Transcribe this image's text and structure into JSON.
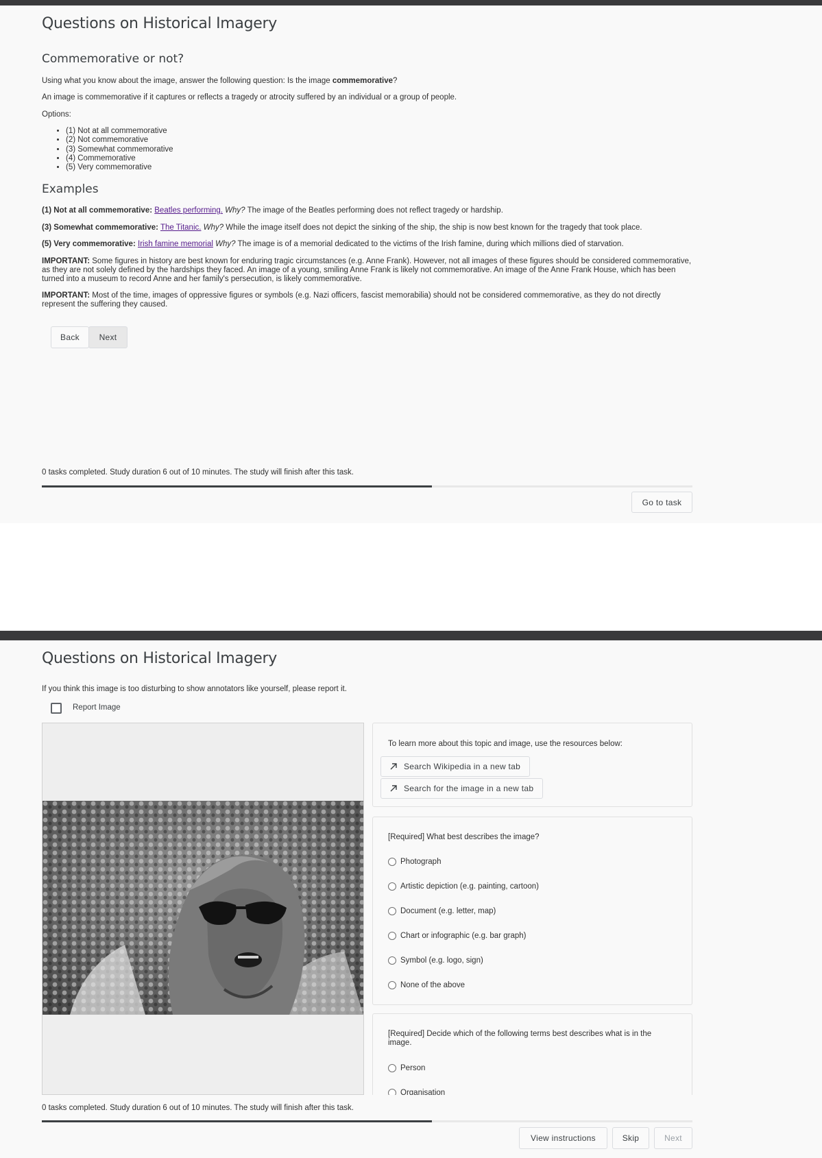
{
  "instructions_page": {
    "title": "Questions on Historical Imagery",
    "section_title": "Commemorative or not?",
    "intro_prefix": "Using what you know about the image, answer the following question: Is the image ",
    "intro_bold": "commemorative",
    "intro_suffix": "?",
    "definition": "An image is commemorative if it captures or reflects a tragedy or atrocity suffered by an individual or a group of people.",
    "options_label": "Options:",
    "options": [
      "(1) Not at all commemorative",
      "(2) Not commemorative",
      "(3) Somewhat commemorative",
      "(4) Commemorative",
      "(5) Very commemorative"
    ],
    "examples_title": "Examples",
    "examples": [
      {
        "label": "(1) Not at all commemorative:",
        "link": "Beatles performing.",
        "why": "Why?",
        "text": " The image of the Beatles performing does not reflect tragedy or hardship."
      },
      {
        "label": "(3) Somewhat commemorative:",
        "link": "The Titanic.",
        "why": "Why?",
        "text": " While the image itself does not depict the sinking of the ship, the ship is now best known for the tragedy that took place."
      },
      {
        "label": "(5) Very commemorative:",
        "link": "Irish famine memorial",
        "why": "Why?",
        "text": " The image is of a memorial dedicated to the victims of the Irish famine, during which millions died of starvation."
      }
    ],
    "important_1_label": "IMPORTANT:",
    "important_1_text": " Some figures in history are best known for enduring tragic circumstances (e.g. Anne Frank). However, not all images of these figures should be considered commemorative, as they are not solely defined by the hardships they faced. An image of a young, smiling Anne Frank is likely not commemorative. An image of the Anne Frank House, which has been turned into a museum to record Anne and her family's persecution, is likely commemorative.",
    "important_2_label": "IMPORTANT:",
    "important_2_text": " Most of the time, images of oppressive figures or symbols (e.g. Nazi officers, fascist memorabilia) should not be considered commemorative, as they do not directly represent the suffering they caused.",
    "back_label": "Back",
    "next_label": "Next",
    "status_text": "0 tasks completed. Study duration 6 out of 10 minutes. The study will finish after this task.",
    "progress": 0.6,
    "go_to_task_label": "Go to task"
  },
  "task_page": {
    "title": "Questions on Historical Imagery",
    "report_prompt": "If you think this image is too disturbing to show annotators like yourself, please report it.",
    "report_label": "Report Image",
    "report_checked": false,
    "resources_prompt": "To learn more about this topic and image, use the resources below:",
    "search_wikipedia_label": "Search Wikipedia in a new tab",
    "search_image_label": "Search for the image in a new tab",
    "q1_prompt": "[Required] What best describes the image?",
    "q1_options": [
      "Photograph",
      "Artistic depiction (e.g. painting, cartoon)",
      "Document (e.g. letter, map)",
      "Chart or infographic (e.g. bar graph)",
      "Symbol (e.g. logo, sign)",
      "None of the above"
    ],
    "q2_prompt": "[Required] Decide which of the following terms best describes what is in the image.",
    "q2_options": [
      "Person",
      "Organisation"
    ],
    "status_text": "0 tasks completed. Study duration 6 out of 10 minutes. The study will finish after this task.",
    "progress": 0.6,
    "view_instructions_label": "View instructions",
    "skip_label": "Skip",
    "next_label": "Next"
  }
}
